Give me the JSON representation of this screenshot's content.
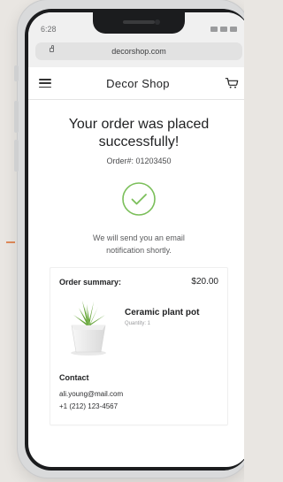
{
  "status_bar": {
    "time": "6:28"
  },
  "browser": {
    "url": "decorshop.com"
  },
  "header": {
    "brand": "Decor Shop",
    "menu_icon": "hamburger-menu-icon",
    "cart_icon": "shopping-cart-icon"
  },
  "confirmation": {
    "title_line1": "Your order was placed",
    "title_line2": "successfully!",
    "order_number": "Order#: 01203450",
    "message_line1": "We will send you an email",
    "message_line2": "notification shortly.",
    "check_icon": "check-circle-icon",
    "accent_color": "#7bbf5a"
  },
  "summary": {
    "label": "Order summary:",
    "amount": "$20.00",
    "product": {
      "name": "Ceramic plant pot",
      "quantity": "Quantity: 1"
    }
  },
  "contact": {
    "label": "Contact",
    "email": "ali.young@mail.com",
    "phone": "+1 (212) 123-4567"
  }
}
